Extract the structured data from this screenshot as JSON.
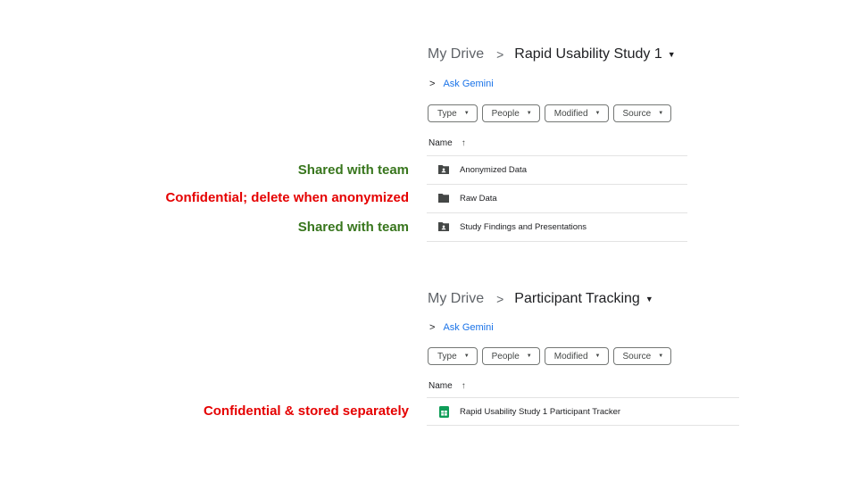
{
  "colors": {
    "green_note": "#38761d",
    "red_note": "#e50000",
    "link": "#1a73e8",
    "sheets_green": "#0f9d58"
  },
  "panels": [
    {
      "breadcrumb": {
        "root": "My Drive",
        "separator": ">",
        "current": "Rapid Usability Study 1"
      },
      "ask_gemini": "Ask Gemini",
      "filters": [
        "Type",
        "People",
        "Modified",
        "Source"
      ],
      "column_header": "Name",
      "rows": [
        {
          "name": "Anonymized Data",
          "icon": "shared-folder-icon"
        },
        {
          "name": "Raw Data",
          "icon": "folder-icon"
        },
        {
          "name": "Study Findings and Presentations",
          "icon": "shared-folder-icon"
        }
      ]
    },
    {
      "breadcrumb": {
        "root": "My Drive",
        "separator": ">",
        "current": "Participant Tracking"
      },
      "ask_gemini": "Ask Gemini",
      "filters": [
        "Type",
        "People",
        "Modified",
        "Source"
      ],
      "column_header": "Name",
      "rows": [
        {
          "name": "Rapid Usability Study 1 Participant Tracker",
          "icon": "google-sheets-icon"
        }
      ]
    }
  ],
  "annotations": [
    {
      "text": "Shared with team",
      "color": "green"
    },
    {
      "text": "Confidential; delete when anonymized",
      "color": "red"
    },
    {
      "text": "Shared with team",
      "color": "green"
    },
    {
      "text": "Confidential & stored separately",
      "color": "red"
    }
  ]
}
